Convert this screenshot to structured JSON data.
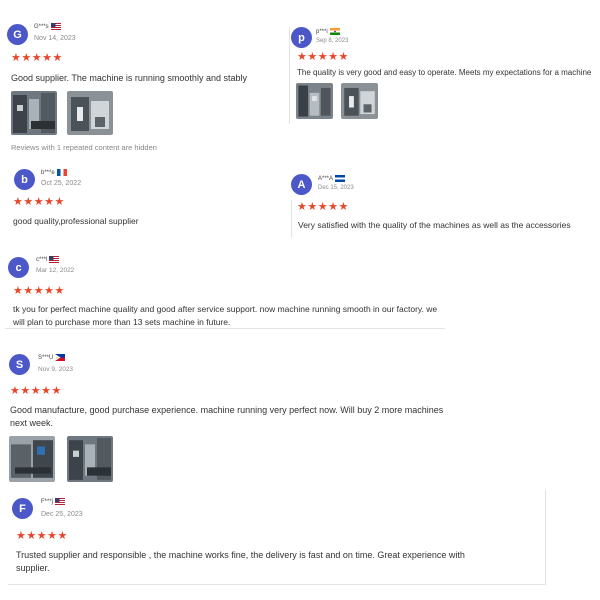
{
  "colors": {
    "avatar": "#4c57c8",
    "star": "#e8462a"
  },
  "stars_label": "★★★★★",
  "reviews": [
    {
      "initial": "G",
      "user": "G***s",
      "flag": "us",
      "date": "Nov 14, 2023",
      "rating": 5,
      "text": "Good supplier. The machine is running smoothly and stably",
      "note": "Reviews with 1 repeated content are hidden"
    },
    {
      "initial": "p",
      "user": "p***i",
      "flag": "in",
      "date": "Sep 8, 2023",
      "rating": 5,
      "text": "The quality is very good and easy to operate. Meets my expectations for a machine"
    },
    {
      "initial": "b",
      "user": "b***e",
      "flag": "fr",
      "date": "Oct 25, 2022",
      "rating": 5,
      "text": "good quality,professional supplier"
    },
    {
      "initial": "A",
      "user": "A***A",
      "flag": "sv",
      "date": "Dec 15, 2023",
      "rating": 5,
      "text": "Very satisfied with the quality of the machines as well as the accessories"
    },
    {
      "initial": "c",
      "user": "c***l",
      "flag": "us",
      "date": "Mar 12, 2022",
      "rating": 5,
      "text": "tk you for perfect machine quality and good after service support. now machine running smooth in our factory. we will plan to purchase more than 13 sets machine in future."
    },
    {
      "initial": "S",
      "user": "S***U",
      "flag": "ph",
      "date": "Nov 9, 2023",
      "rating": 5,
      "text": "Good manufacture, good purchase experience. machine running very perfect now. Will buy 2 more machines next week."
    },
    {
      "initial": "F",
      "user": "F***j",
      "flag": "us",
      "date": "Dec 25, 2023",
      "rating": 5,
      "text": "Trusted supplier and responsible , the machine works fine, the delivery is fast and on time. Great experience with supplier."
    }
  ]
}
